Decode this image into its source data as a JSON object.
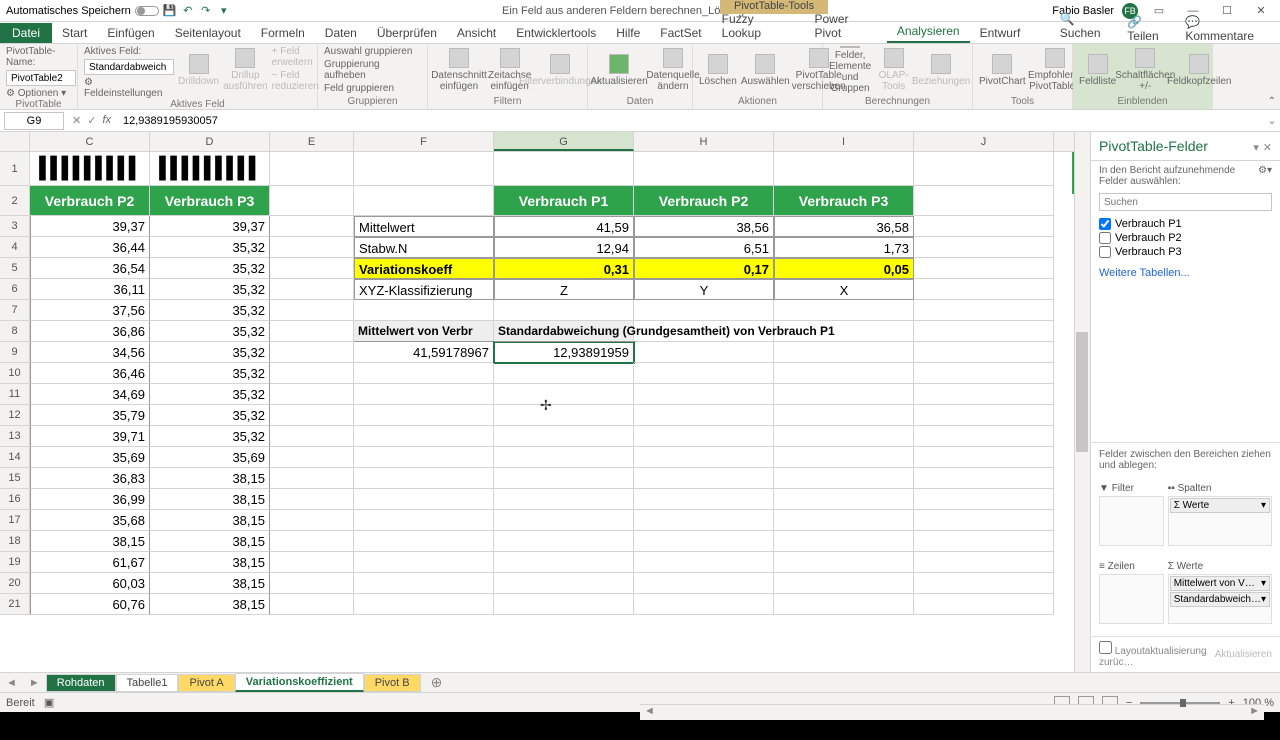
{
  "titlebar": {
    "autosave": "Automatisches Speichern",
    "doc_title": "Ein Feld aus anderen Feldern berechnen_Lösung - Excel",
    "context_tab": "PivotTable-Tools",
    "user": "Fabio Basler",
    "user_initials": "FB"
  },
  "ribbon_tabs": {
    "file": "Datei",
    "items": [
      "Start",
      "Einfügen",
      "Seitenlayout",
      "Formeln",
      "Daten",
      "Überprüfen",
      "Ansicht",
      "Entwicklertools",
      "Hilfe",
      "FactSet",
      "Fuzzy Lookup",
      "Power Pivot",
      "Analysieren",
      "Entwurf"
    ],
    "active": "Analysieren",
    "search": "Suchen",
    "share": "Teilen",
    "comments": "Kommentare"
  },
  "ribbon": {
    "pt_name_lbl": "PivotTable-Name:",
    "pt_name_val": "PivotTable2",
    "options_btn": "Optionen",
    "pivottable_grp": "PivotTable",
    "aktives_feld_lbl": "Aktives Feld:",
    "aktives_feld_val": "Standardabweich",
    "feldeinst": "Feldeinstellungen",
    "drilldown": "Drilldown",
    "drillup": "Drillup ausführen",
    "feld_erweitern": "Feld erweitern",
    "feld_reduzieren": "Feld reduzieren",
    "aktives_feld_grp": "Aktives Feld",
    "ausw_grup": "Auswahl gruppieren",
    "grup_aufheben": "Gruppierung aufheben",
    "feld_grup": "Feld gruppieren",
    "gruppieren_grp": "Gruppieren",
    "datenschnitt": "Datenschnitt einfügen",
    "zeitachse": "Zeitachse einfügen",
    "filterverb": "Filterverbindungen",
    "filtern_grp": "Filtern",
    "aktualisieren": "Aktualisieren",
    "datenquelle": "Datenquelle ändern",
    "daten_grp": "Daten",
    "loeschen": "Löschen",
    "auswaehlen": "Auswählen",
    "verschieben": "PivotTable verschieben",
    "aktionen_grp": "Aktionen",
    "felder_elem": "Felder, Elemente und Gruppen",
    "olap": "OLAP-Tools",
    "beziehungen": "Beziehungen",
    "berechnungen_grp": "Berechnungen",
    "pivotchart": "PivotChart",
    "empfohlene": "Empfohlene PivotTables",
    "tools_grp": "Tools",
    "feldliste": "Feldliste",
    "schaltfl": "Schaltflächen +/-",
    "feldkopf": "Feldkopfzeilen",
    "einblenden_grp": "Einblenden"
  },
  "namebox": "G9",
  "formula": "12,9389195930057",
  "columns": [
    "C",
    "D",
    "E",
    "F",
    "G",
    "H",
    "I",
    "J"
  ],
  "row1_barcode": "▌▌▌▌▌▌▌▌▌",
  "headers": {
    "p2": "Verbrauch P2",
    "p3": "Verbrauch P3",
    "p1": "Verbrauch P1"
  },
  "stats_labels": {
    "mittelwert": "Mittelwert",
    "stabw": "Stabw.N",
    "varkoeff": "Variationskoeff",
    "xyz": "XYZ-Klassifizierung"
  },
  "stats": {
    "mw": {
      "g": "41,59",
      "h": "38,56",
      "i": "36,58"
    },
    "st": {
      "g": "12,94",
      "h": "6,51",
      "i": "1,73"
    },
    "vk": {
      "g": "0,31",
      "h": "0,17",
      "i": "0,05"
    },
    "xy": {
      "g": "Z",
      "h": "Y",
      "i": "X"
    }
  },
  "pivot_hdr": {
    "f": "Mittelwert von Verbr",
    "g": "Standardabweichung (Grundgesamtheit) von Verbrauch P1"
  },
  "pivot_vals": {
    "f": "41,59178967",
    "g": "12,93891959"
  },
  "col_c": [
    "39,37",
    "36,44",
    "36,54",
    "36,11",
    "37,56",
    "36,86",
    "34,56",
    "36,46",
    "34,69",
    "35,79",
    "39,71",
    "35,69",
    "36,83",
    "36,99",
    "35,68",
    "38,15",
    "61,67",
    "60,03",
    "60,76"
  ],
  "col_d": [
    "39,37",
    "35,32",
    "35,32",
    "35,32",
    "35,32",
    "35,32",
    "35,32",
    "35,32",
    "35,32",
    "35,32",
    "35,32",
    "35,69",
    "38,15",
    "38,15",
    "38,15",
    "38,15",
    "38,15",
    "38,15",
    "38,15"
  ],
  "sheets": {
    "rohdaten": "Rohdaten",
    "tabelle1": "Tabelle1",
    "pivotA": "Pivot A",
    "varkoeff": "Variationskoeffizient",
    "pivotB": "Pivot B"
  },
  "taskpane": {
    "title": "PivotTable-Felder",
    "subtitle": "In den Bericht aufzunehmende Felder auswählen:",
    "search_ph": "Suchen",
    "fields": [
      "Verbrauch P1",
      "Verbrauch P2",
      "Verbrauch P3"
    ],
    "more_tables": "Weitere Tabellen...",
    "drag_note": "Felder zwischen den Bereichen ziehen und ablegen:",
    "filter": "Filter",
    "spalten": "Spalten",
    "zeilen": "Zeilen",
    "werte": "Werte",
    "werte_chip": "Σ Werte",
    "val1": "Mittelwert von V…",
    "val2": "Standardabweich…",
    "layout_update": "Layoutaktualisierung zurüc…",
    "update_btn": "Aktualisieren"
  },
  "statusbar": {
    "ready": "Bereit",
    "zoom": "100 %"
  }
}
